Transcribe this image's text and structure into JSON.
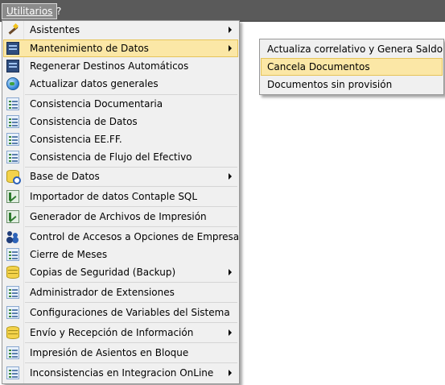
{
  "menubar": {
    "items": [
      {
        "label": "Utilitarios",
        "underline": "U"
      },
      {
        "label": "?"
      }
    ]
  },
  "main_menu": {
    "items": [
      {
        "label": "Asistentes",
        "icon": "wand-icon",
        "submenu": true
      },
      {
        "label": "Mantenimiento de Datos",
        "icon": "database-tool-icon",
        "submenu": true,
        "highlighted": true
      },
      {
        "label": "Regenerar Destinos Automáticos",
        "icon": "database-tool-icon"
      },
      {
        "label": "Actualizar datos generales",
        "icon": "globe-icon"
      },
      {
        "label": "Consistencia Documentaria",
        "icon": "list-icon"
      },
      {
        "label": "Consistencia de Datos",
        "icon": "list-icon"
      },
      {
        "label": "Consistencia EE.FF.",
        "icon": "list-icon"
      },
      {
        "label": "Consistencia de Flujo del Efectivo",
        "icon": "list-icon"
      },
      {
        "label": "Base de Datos",
        "icon": "database-search-icon",
        "submenu": true
      },
      {
        "label": "Importador de datos Contaple SQL",
        "icon": "import-icon"
      },
      {
        "label": "Generador de Archivos de Impresión",
        "icon": "import-icon"
      },
      {
        "label": "Control de Accesos a Opciones de Empresa",
        "icon": "users-icon"
      },
      {
        "label": "Cierre de Meses",
        "icon": "list-icon"
      },
      {
        "label": "Copias de Seguridad (Backup)",
        "icon": "database-icon",
        "submenu": true
      },
      {
        "label": "Administrador de Extensiones",
        "icon": "list-icon"
      },
      {
        "label": "Configuraciones de Variables del Sistema",
        "icon": "list-icon"
      },
      {
        "label": "Envío y Recepción de Información",
        "icon": "database-icon",
        "submenu": true
      },
      {
        "label": "Impresión de Asientos en Bloque",
        "icon": "list-icon"
      },
      {
        "label": "Inconsistencias en Integracion OnLine",
        "icon": "list-icon",
        "submenu": true
      }
    ]
  },
  "sub_menu": {
    "items": [
      {
        "label": "Actualiza correlativo y Genera Saldo"
      },
      {
        "label": "Cancela Documentos",
        "highlighted": true
      },
      {
        "label": "Documentos sin provisión"
      }
    ]
  },
  "colors": {
    "menubar_bg": "#5a5a5a",
    "highlight_bg": "#fbe7a6",
    "highlight_border": "#e6c45a",
    "menu_bg": "#f0f0f0"
  }
}
